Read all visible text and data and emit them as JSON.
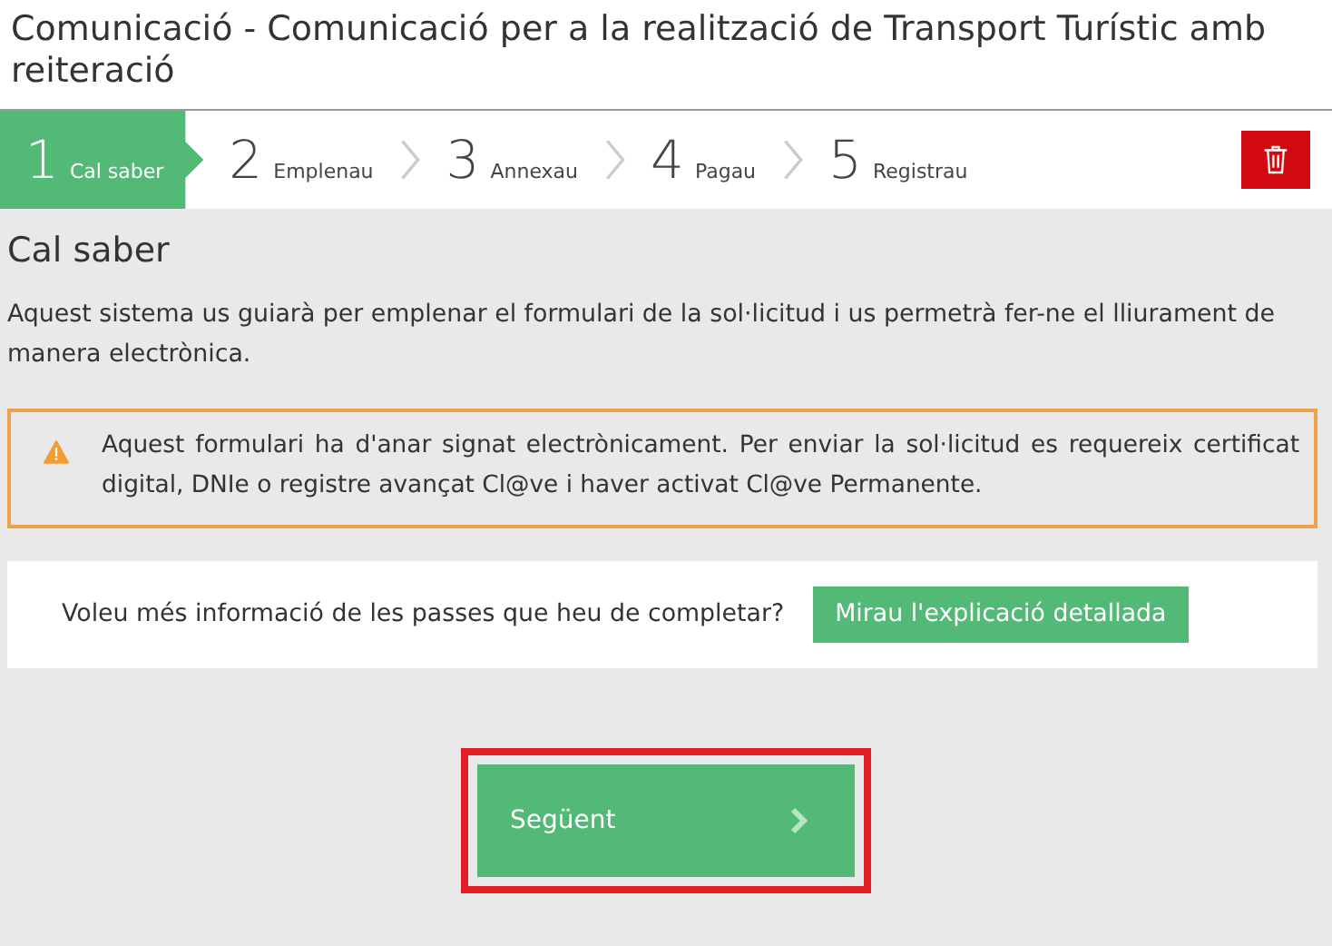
{
  "title": "Comunicació - Comunicació per a la realització de Transport Turístic amb reiteració",
  "steps": [
    {
      "number": "1",
      "label": "Cal saber",
      "selected": true
    },
    {
      "number": "2",
      "label": "Emplenau",
      "selected": false
    },
    {
      "number": "3",
      "label": "Annexau",
      "selected": false
    },
    {
      "number": "4",
      "label": "Pagau",
      "selected": false
    },
    {
      "number": "5",
      "label": "Registrau",
      "selected": false
    }
  ],
  "heading": "Cal saber",
  "intro": "Aquest sistema us guiarà  per emplenar el formulari de la sol·licitud i us permetrà  fer-ne el lliurament de manera electrònica.",
  "warning": "Aquest formulari ha d'anar signat electrònicament. Per enviar la sol·licitud es requereix certificat digital, DNIe o registre avançat Cl@ve i haver activat Cl@ve Permanente.",
  "info": {
    "question": "Voleu més informació de les passes que heu de completar?",
    "button": "Mirau l'explicació detallada"
  },
  "next": {
    "label": "Següent",
    "highlighted": true
  }
}
